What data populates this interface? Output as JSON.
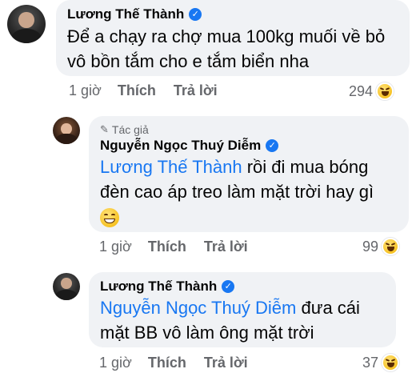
{
  "comments": [
    {
      "author": "Lương Thế Thành",
      "verified": true,
      "text": "Để a chạy ra chợ mua 100kg muối về bỏ vô bồn tắm cho e tắm biển nha",
      "time": "1 giờ",
      "like_label": "Thích",
      "reply_label": "Trả lời",
      "reaction_count": "294",
      "reaction_icon": "haha-icon"
    },
    {
      "author_tag": "Tác giả",
      "author": "Nguyễn Ngọc Thuý Diễm",
      "verified": true,
      "mention": "Lương Thế Thành",
      "text_line1": " rồi đi mua bóng",
      "text_line2": "đèn cao áp treo làm mặt trời hay gì",
      "emoji": "grinning-squinting-face",
      "time": "1 giờ",
      "like_label": "Thích",
      "reply_label": "Trả lời",
      "reaction_count": "99",
      "reaction_icon": "haha-icon"
    },
    {
      "author": "Lương Thế Thành",
      "verified": true,
      "mention": "Nguyễn Ngọc Thuý Diễm",
      "text_line1": " đưa cái",
      "text_line2": "mặt BB vô làm ông mặt trời",
      "time": "1 giờ",
      "like_label": "Thích",
      "reply_label": "Trả lời",
      "reaction_count": "37",
      "reaction_icon": "haha-icon"
    }
  ],
  "colors": {
    "bubble": "#f0f2f5",
    "mention": "#1877f2",
    "verified": "#1877f2",
    "meta_text": "#65676b"
  }
}
